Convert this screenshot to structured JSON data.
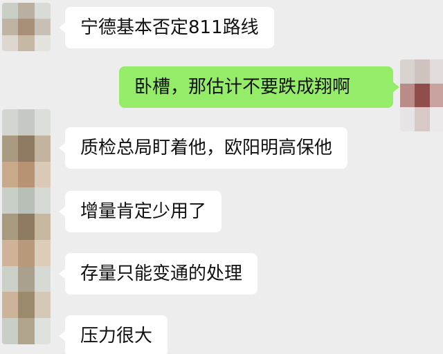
{
  "colors": {
    "background": "#ededed",
    "incoming_bubble": "#ffffff",
    "outgoing_bubble": "#95ec69",
    "text": "#111111"
  },
  "messages": [
    {
      "side": "incoming",
      "text": "宁德基本否定811路线"
    },
    {
      "side": "outgoing",
      "text": "卧槽，那估计不要跌成翔啊"
    },
    {
      "side": "incoming",
      "text": "质检总局盯着他，欧阳明高保他"
    },
    {
      "side": "incoming",
      "text": "增量肯定少用了"
    },
    {
      "side": "incoming",
      "text": "存量只能变通的处理"
    },
    {
      "side": "incoming",
      "text": "压力很大"
    }
  ]
}
